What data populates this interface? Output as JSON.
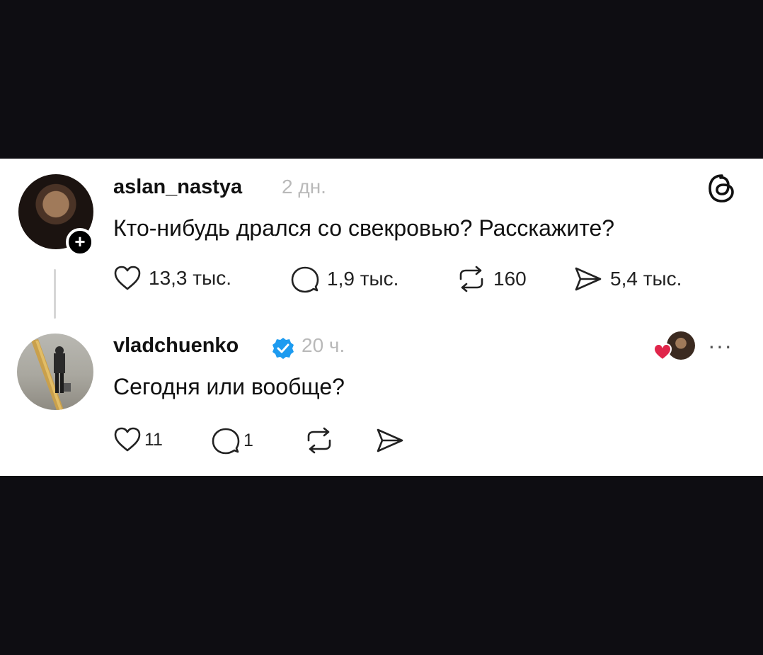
{
  "posts": [
    {
      "username": "aslan_nastya",
      "time": "2 дн.",
      "text": "Кто-нибудь дрался со свекровью? Расскажите?",
      "follow_badge": "+",
      "likes": "13,3 тыс.",
      "replies": "1,9 тыс.",
      "reposts": "160",
      "shares": "5,4 тыс."
    },
    {
      "username": "vladchuenko",
      "time": "20 ч.",
      "text": "Сегодня или вообще?",
      "verified": true,
      "likes": "11",
      "replies": "1",
      "more": "···"
    }
  ],
  "colors": {
    "verified": "#1d9bf0",
    "heart": "#e0254a",
    "muted_text": "#b9b9b9",
    "background": "#0e0d12",
    "card": "#ffffff"
  },
  "icons": [
    "threads-logo-icon",
    "heart-icon",
    "comment-icon",
    "repost-icon",
    "share-icon",
    "verified-badge-icon",
    "more-icon"
  ]
}
